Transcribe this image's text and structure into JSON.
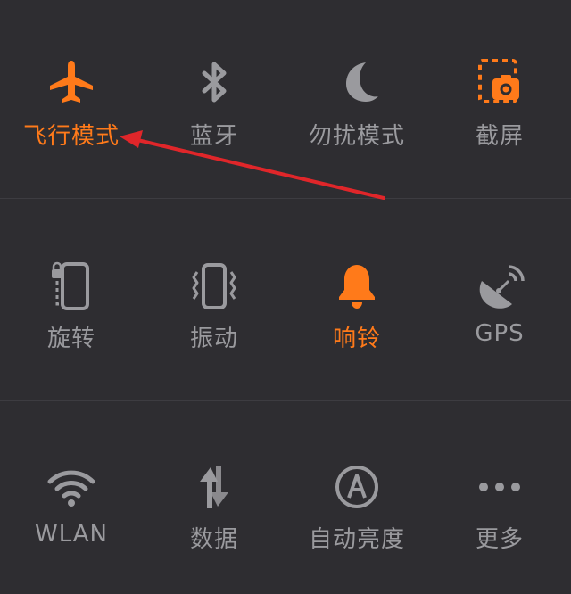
{
  "colors": {
    "background": "#2e2d31",
    "active": "#ff7a1a",
    "inactive": "#9a9a9e",
    "arrow": "#e0262a"
  },
  "tiles": [
    {
      "label": "飞行模式",
      "icon": "airplane-icon",
      "active": true
    },
    {
      "label": "蓝牙",
      "icon": "bluetooth-icon",
      "active": false
    },
    {
      "label": "勿扰模式",
      "icon": "moon-icon",
      "active": false
    },
    {
      "label": "截屏",
      "icon": "screenshot-icon",
      "active": true
    },
    {
      "label": "旋转",
      "icon": "rotation-lock-icon",
      "active": false
    },
    {
      "label": "振动",
      "icon": "vibrate-icon",
      "active": false
    },
    {
      "label": "响铃",
      "icon": "bell-icon",
      "active": true
    },
    {
      "label": "GPS",
      "icon": "gps-icon",
      "active": false
    },
    {
      "label": "WLAN",
      "icon": "wifi-icon",
      "active": false
    },
    {
      "label": "数据",
      "icon": "data-transfer-icon",
      "active": false
    },
    {
      "label": "自动亮度",
      "icon": "auto-brightness-icon",
      "active": false
    },
    {
      "label": "更多",
      "icon": "more-icon",
      "active": false
    }
  ]
}
